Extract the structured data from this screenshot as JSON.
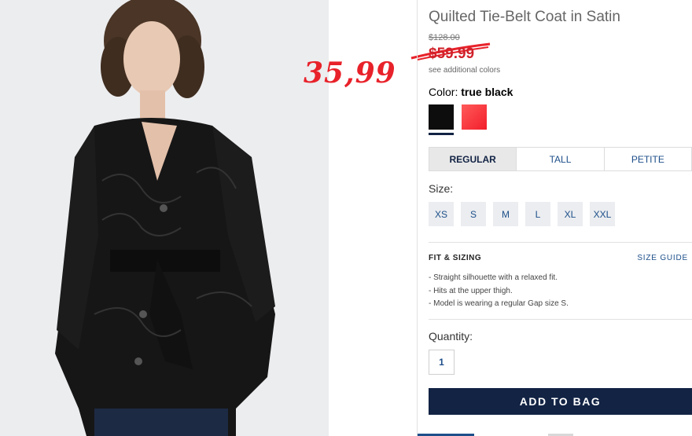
{
  "product": {
    "title": "Quilted Tie-Belt Coat in Satin",
    "original_price": "$128.00",
    "sale_price": "$59.99",
    "see_colors": "see additional colors"
  },
  "overlay_price": "35,99",
  "color": {
    "label": "Color:",
    "selected": "true black",
    "swatches": [
      "true black",
      "red"
    ]
  },
  "fit_tabs": [
    "REGULAR",
    "TALL",
    "PETITE"
  ],
  "size": {
    "label": "Size:",
    "options": [
      "XS",
      "S",
      "M",
      "L",
      "XL",
      "XXL"
    ]
  },
  "fit_sizing": {
    "heading": "FIT & SIZING",
    "guide_link": "SIZE GUIDE",
    "bullets": [
      "- Straight silhouette with a relaxed fit.",
      "- Hits at the upper thigh.",
      "- Model is wearing a regular Gap size S."
    ]
  },
  "quantity": {
    "label": "Quantity:",
    "value": "1"
  },
  "add_to_bag": "ADD TO BAG",
  "colors": {
    "navy": "#122344",
    "sale_red": "#d0212a",
    "link_blue": "#1d4f8a"
  }
}
